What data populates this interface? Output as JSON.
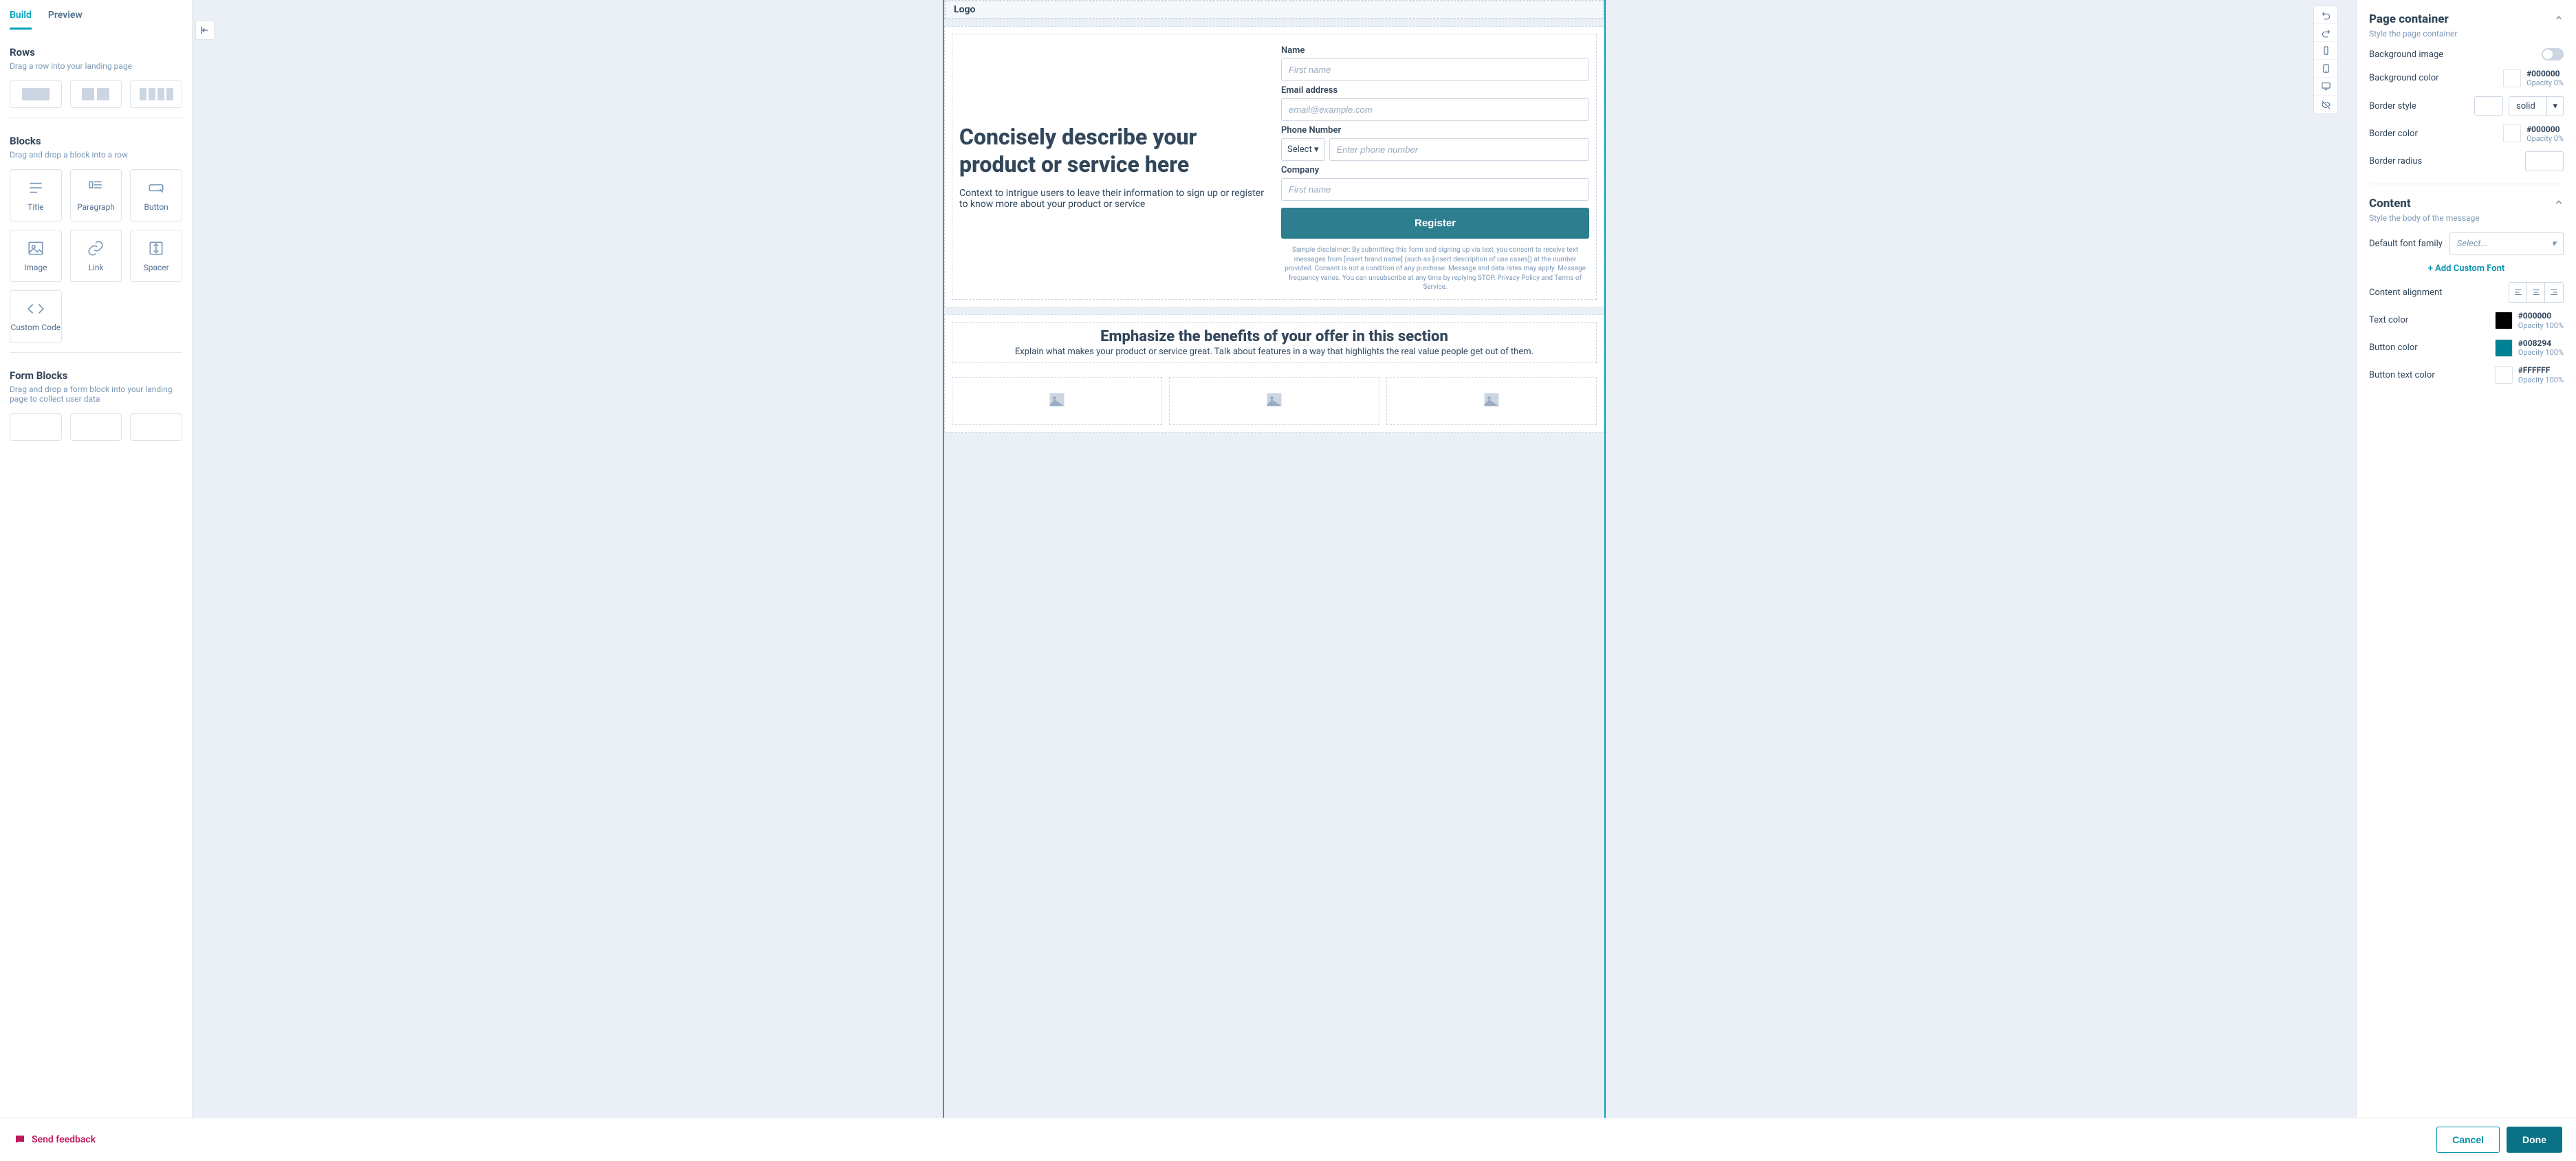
{
  "tabs": {
    "build": "Build",
    "preview": "Preview"
  },
  "rows": {
    "title": "Rows",
    "sub": "Drag a row into your landing page"
  },
  "blocks": {
    "title": "Blocks",
    "sub": "Drag and drop a block into a row",
    "items": [
      "Title",
      "Paragraph",
      "Button",
      "Image",
      "Link",
      "Spacer",
      "Custom Code"
    ]
  },
  "formBlocks": {
    "title": "Form Blocks",
    "sub": "Drag and drop a form block into your landing page to collect user data"
  },
  "canvas": {
    "logo": "Logo",
    "heroTitle": "Concisely describe your product or service here",
    "heroSub": "Context to intrigue users to leave their information to sign up or register to know more about your product or service",
    "form": {
      "nameLabel": "Name",
      "namePH": "First name",
      "emailLabel": "Email address",
      "emailPH": "email@example.com",
      "phoneLabel": "Phone Number",
      "phoneSelect": "Select",
      "phonePH": "Enter phone number",
      "companyLabel": "Company",
      "companyPH": "First name",
      "submit": "Register",
      "disclaimer": "Sample disclaimer: By submitting this form and signing up via text, you consent to receive text messages from [insert brand name] (such as [insert description of use cases]) at the number provided. Consent is not a condition of any purchase. Message and data rates may apply. Message frequency varies. You can unsubscribe at any time by replying STOP. Privacy Policy and Terms of Service."
    },
    "benefitsTitle": "Emphasize the benefits of your offer in this section",
    "benefitsSub": "Explain what makes your product or service great. Talk about features in a way that highlights the real value people get out of them."
  },
  "right": {
    "pageContainer": {
      "title": "Page container",
      "sub": "Style the page container"
    },
    "bgImage": "Background image",
    "bgColor": {
      "label": "Background color",
      "hex": "#000000",
      "opacity": "Opacity 0%"
    },
    "borderStyle": {
      "label": "Border style",
      "value": "solid"
    },
    "borderColor": {
      "label": "Border color",
      "hex": "#000000",
      "opacity": "Opacity 0%"
    },
    "borderRadius": {
      "label": "Border radius",
      "value": ""
    },
    "content": {
      "title": "Content",
      "sub": "Style the body of the message"
    },
    "fontFamily": {
      "label": "Default font family",
      "placeholder": "Select..."
    },
    "addFont": "+ Add Custom Font",
    "contentAlign": "Content alignment",
    "textColor": {
      "label": "Text color",
      "hex": "#000000",
      "opacity": "Opacity 100%"
    },
    "buttonColor": {
      "label": "Button color",
      "hex": "#008294",
      "opacity": "Opacity 100%"
    },
    "buttonTextColor": {
      "label": "Button text color",
      "hex": "#FFFFFF",
      "opacity": "Opacity 100%"
    }
  },
  "footer": {
    "feedback": "Send feedback",
    "cancel": "Cancel",
    "done": "Done"
  }
}
